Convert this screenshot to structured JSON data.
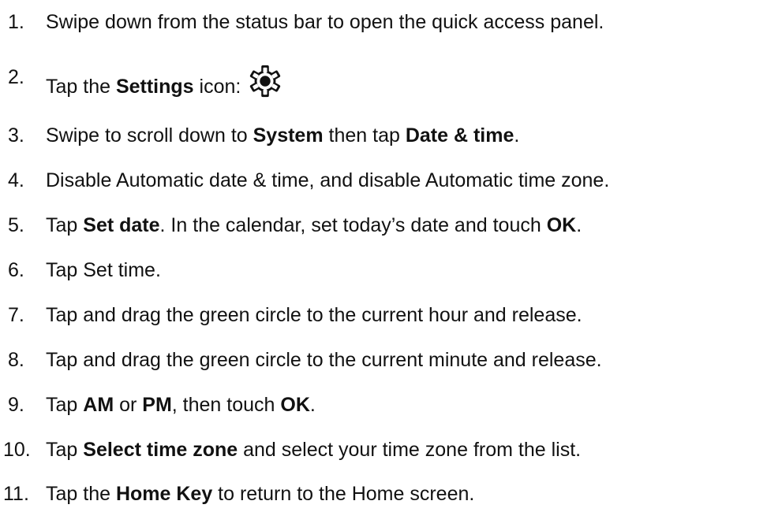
{
  "steps": [
    {
      "number": "1.",
      "parts": [
        {
          "text": "Swipe down from the status bar to open the quick access panel.",
          "bold": false
        }
      ]
    },
    {
      "number": "2.",
      "parts": [
        {
          "text": "Tap the ",
          "bold": false
        },
        {
          "text": "Settings",
          "bold": true
        },
        {
          "text": " icon:",
          "bold": false
        }
      ],
      "icon": "settings-gear-icon"
    },
    {
      "number": "3.",
      "parts": [
        {
          "text": "Swipe to scroll down to ",
          "bold": false
        },
        {
          "text": "System",
          "bold": true
        },
        {
          "text": " then tap ",
          "bold": false
        },
        {
          "text": "Date & time",
          "bold": true
        },
        {
          "text": ".",
          "bold": false
        }
      ]
    },
    {
      "number": "4.",
      "parts": [
        {
          "text": "Disable Automatic date & time, and disable Automatic time zone.",
          "bold": false
        }
      ]
    },
    {
      "number": "5.",
      "parts": [
        {
          "text": "Tap ",
          "bold": false
        },
        {
          "text": "Set date",
          "bold": true
        },
        {
          "text": ". In the calendar, set today’s date and touch ",
          "bold": false
        },
        {
          "text": "OK",
          "bold": true
        },
        {
          "text": ".",
          "bold": false
        }
      ]
    },
    {
      "number": "6.",
      "parts": [
        {
          "text": "Tap Set time.",
          "bold": false
        }
      ]
    },
    {
      "number": "7.",
      "parts": [
        {
          "text": "Tap and drag the green circle to the current hour and release.",
          "bold": false
        }
      ]
    },
    {
      "number": "8.",
      "parts": [
        {
          "text": "Tap and drag the green circle to the current minute and release.",
          "bold": false
        }
      ]
    },
    {
      "number": "9.",
      "parts": [
        {
          "text": "Tap ",
          "bold": false
        },
        {
          "text": "AM",
          "bold": true
        },
        {
          "text": " or ",
          "bold": false
        },
        {
          "text": "PM",
          "bold": true
        },
        {
          "text": ", then touch ",
          "bold": false
        },
        {
          "text": "OK",
          "bold": true
        },
        {
          "text": ".",
          "bold": false
        }
      ]
    },
    {
      "number": "10.",
      "parts": [
        {
          "text": "Tap ",
          "bold": false
        },
        {
          "text": "Select time zone",
          "bold": true
        },
        {
          "text": " and select your time zone from the list.",
          "bold": false
        }
      ]
    },
    {
      "number": "11.",
      "parts": [
        {
          "text": "Tap the ",
          "bold": false
        },
        {
          "text": "Home Key",
          "bold": true
        },
        {
          "text": " to return to the Home screen.",
          "bold": false
        }
      ]
    }
  ]
}
